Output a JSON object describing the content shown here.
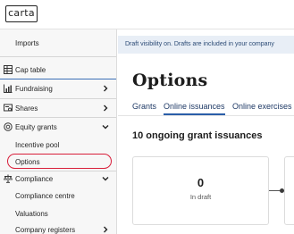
{
  "brand": {
    "logo_text": "carta"
  },
  "sidebar": {
    "items": [
      {
        "key": "imports",
        "label": "Imports",
        "icon": "none",
        "chevron": false
      },
      {
        "key": "cap-table",
        "label": "Cap table",
        "icon": "table-icon",
        "chevron": false
      },
      {
        "key": "fundraising",
        "label": "Fundraising",
        "icon": "chart-icon",
        "chevron": "right"
      },
      {
        "key": "shares",
        "label": "Shares",
        "icon": "certificate-icon",
        "chevron": "right"
      },
      {
        "key": "equity-grants",
        "label": "Equity grants",
        "icon": "badge-icon",
        "chevron": "down"
      },
      {
        "key": "incentive-pool",
        "label": "Incentive pool",
        "icon": "none",
        "chevron": false
      },
      {
        "key": "options",
        "label": "Options",
        "icon": "none",
        "chevron": false,
        "selected": true
      },
      {
        "key": "compliance",
        "label": "Compliance",
        "icon": "scales-icon",
        "chevron": "down"
      },
      {
        "key": "compliance-centre",
        "label": "Compliance centre",
        "icon": "none",
        "chevron": false
      },
      {
        "key": "valuations",
        "label": "Valuations",
        "icon": "none",
        "chevron": false
      },
      {
        "key": "company-registers",
        "label": "Company registers",
        "icon": "none",
        "chevron": "right"
      }
    ]
  },
  "banner": {
    "text": "Draft visibility on. Drafts are included in your company"
  },
  "main": {
    "title": "Options",
    "tabs": [
      {
        "label": "Grants",
        "active": false
      },
      {
        "label": "Online issuances",
        "active": true
      },
      {
        "label": "Online exercises",
        "active": false
      }
    ],
    "section_title": "10 ongoing grant issuances",
    "cards": [
      {
        "count": "0",
        "label": "In draft"
      }
    ]
  },
  "colors": {
    "accent_blue": "#2a5ea8",
    "highlight_red": "#d81e3a",
    "banner_bg": "#e8eef6",
    "sidebar_bg": "#f7f7f7"
  }
}
